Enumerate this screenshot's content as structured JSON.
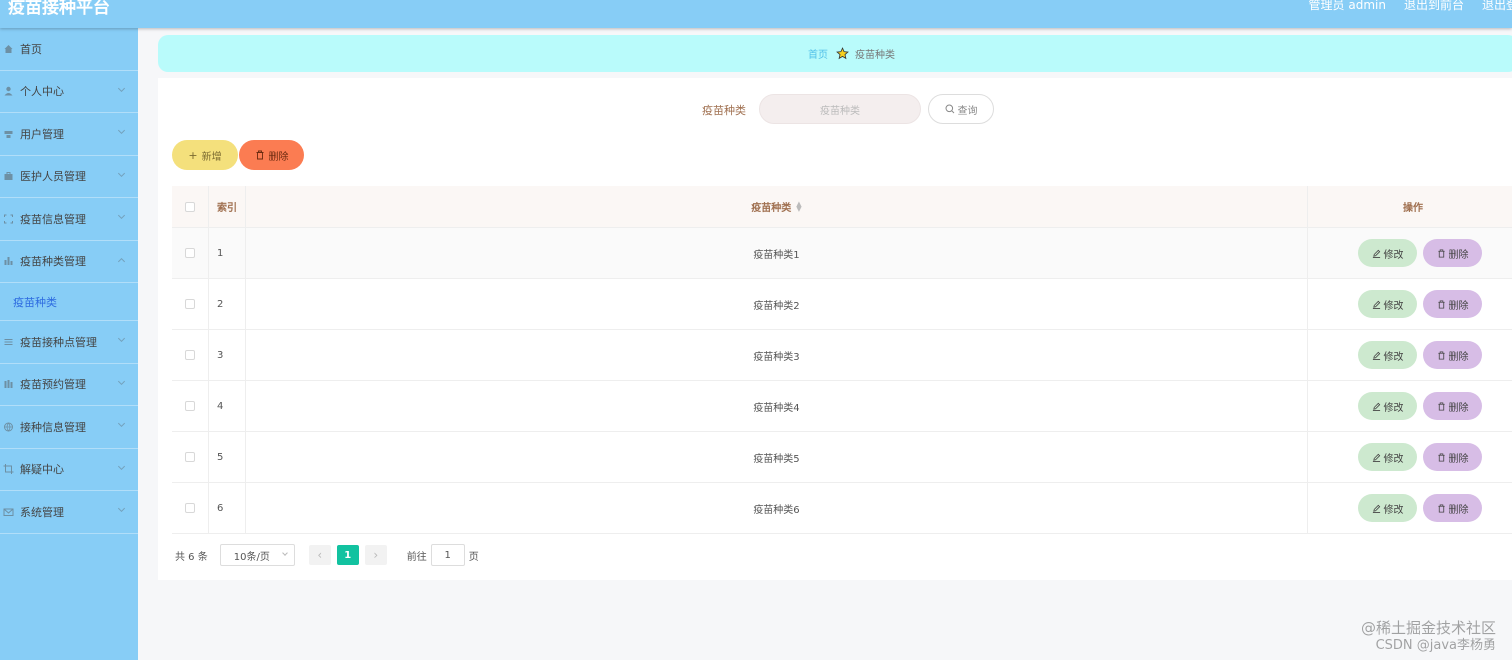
{
  "app": {
    "title": "疫苗接种平台",
    "admin_label": "管理员 admin",
    "to_front": "退出到前台",
    "logout": "退出登"
  },
  "sidebar": {
    "items": [
      {
        "label": "首页",
        "icon": "home-icon"
      },
      {
        "label": "个人中心",
        "icon": "user-icon"
      },
      {
        "label": "用户管理",
        "icon": "users-icon"
      },
      {
        "label": "医护人员管理",
        "icon": "briefcase-icon"
      },
      {
        "label": "疫苗信息管理",
        "icon": "frame-icon"
      },
      {
        "label": "疫苗种类管理",
        "icon": "bar-chart-icon",
        "expanded": true
      },
      {
        "label": "疫苗种类",
        "sub": true,
        "active": true
      },
      {
        "label": "疫苗接种点管理",
        "icon": "list-icon"
      },
      {
        "label": "疫苗预约管理",
        "icon": "columns-icon"
      },
      {
        "label": "接种信息管理",
        "icon": "globe-icon"
      },
      {
        "label": "解疑中心",
        "icon": "crop-icon"
      },
      {
        "label": "系统管理",
        "icon": "mail-icon"
      }
    ]
  },
  "breadcrumb": {
    "home": "首页",
    "current": "疫苗种类"
  },
  "search": {
    "label": "疫苗种类",
    "placeholder": "疫苗种类",
    "query_label": "查询"
  },
  "actions": {
    "add_label": "新增",
    "delete_label": "删除"
  },
  "table": {
    "headers": {
      "index": "索引",
      "type": "疫苗种类",
      "ops": "操作"
    },
    "rows": [
      {
        "index": "1",
        "type": "疫苗种类1"
      },
      {
        "index": "2",
        "type": "疫苗种类2"
      },
      {
        "index": "3",
        "type": "疫苗种类3"
      },
      {
        "index": "4",
        "type": "疫苗种类4"
      },
      {
        "index": "5",
        "type": "疫苗种类5"
      },
      {
        "index": "6",
        "type": "疫苗种类6"
      }
    ],
    "edit_label": "修改",
    "remove_label": "删除"
  },
  "pagination": {
    "total": "共 6 条",
    "page_size": "10条/页",
    "current_page": "1",
    "goto_prefix": "前往",
    "goto_value": "1",
    "goto_suffix": "页"
  },
  "watermark": {
    "line1": "@稀土掘金技术社区",
    "line2": "CSDN @java李杨勇"
  },
  "colors": {
    "topbar": "#87cdf6",
    "breadcrumb_bg": "#b9fbfb",
    "add_button": "#f4e07c",
    "delete_button": "#fb7c52",
    "edit_button": "#cde9cf",
    "row_delete_button": "#d7bde6",
    "active_page": "#12c2a0"
  }
}
